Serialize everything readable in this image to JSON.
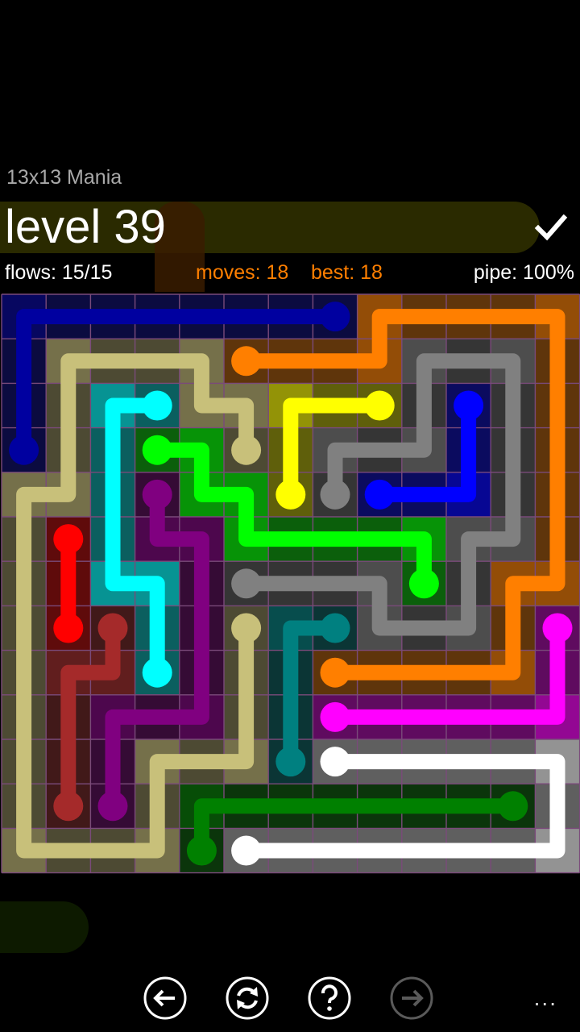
{
  "header": {
    "pack_title": "13x13 Mania",
    "level_label": "level 39",
    "check_icon": "checkmark-icon"
  },
  "stats": {
    "flows": "flows: 15/15",
    "moves": "moves: 18",
    "best": "best: 18",
    "pipe": "pipe: 100%"
  },
  "colors": {
    "background": "#000000",
    "moves_text": "#ff7f00",
    "banner": "#2a2a00",
    "grid_line": "#7a4a7a"
  },
  "board": {
    "size": 13,
    "flows": [
      {
        "name": "navy",
        "color": "#0000a0",
        "path": [
          [
            7,
            0
          ],
          [
            0,
            0
          ],
          [
            0,
            3
          ]
        ]
      },
      {
        "name": "orange",
        "color": "#ff7f00",
        "path": [
          [
            5,
            1
          ],
          [
            8,
            1
          ],
          [
            8,
            0
          ],
          [
            12,
            0
          ],
          [
            12,
            6
          ],
          [
            11,
            6
          ],
          [
            11,
            8
          ],
          [
            7,
            8
          ]
        ]
      },
      {
        "name": "khaki",
        "color": "#c8c07a",
        "path": [
          [
            5,
            3
          ],
          [
            5,
            2
          ],
          [
            4,
            2
          ],
          [
            4,
            1
          ],
          [
            1,
            1
          ],
          [
            1,
            4
          ],
          [
            0,
            4
          ],
          [
            0,
            12
          ],
          [
            3,
            12
          ],
          [
            3,
            10
          ],
          [
            5,
            10
          ],
          [
            5,
            7
          ]
        ]
      },
      {
        "name": "cyan",
        "color": "#00ffff",
        "path": [
          [
            3,
            2
          ],
          [
            2,
            2
          ],
          [
            2,
            6
          ],
          [
            3,
            6
          ],
          [
            3,
            8
          ]
        ]
      },
      {
        "name": "yellow",
        "color": "#ffff00",
        "path": [
          [
            8,
            2
          ],
          [
            6,
            2
          ],
          [
            6,
            4
          ]
        ]
      },
      {
        "name": "gray",
        "color": "#808080",
        "path": [
          [
            7,
            4
          ],
          [
            7,
            3
          ],
          [
            9,
            3
          ],
          [
            9,
            1
          ],
          [
            11,
            1
          ],
          [
            11,
            5
          ],
          [
            10,
            5
          ],
          [
            10,
            7
          ],
          [
            8,
            7
          ],
          [
            8,
            6
          ],
          [
            5,
            6
          ]
        ]
      },
      {
        "name": "blue",
        "color": "#0000ff",
        "path": [
          [
            10,
            2
          ],
          [
            10,
            4
          ],
          [
            8,
            4
          ]
        ]
      },
      {
        "name": "lime",
        "color": "#00ff00",
        "path": [
          [
            3,
            3
          ],
          [
            4,
            3
          ],
          [
            4,
            4
          ],
          [
            5,
            4
          ],
          [
            5,
            5
          ],
          [
            9,
            5
          ],
          [
            9,
            6
          ]
        ]
      },
      {
        "name": "purple",
        "color": "#800080",
        "path": [
          [
            3,
            4
          ],
          [
            3,
            5
          ],
          [
            4,
            5
          ],
          [
            4,
            9
          ],
          [
            2,
            9
          ],
          [
            2,
            11
          ]
        ]
      },
      {
        "name": "red",
        "color": "#ff0000",
        "path": [
          [
            1,
            5
          ],
          [
            1,
            7
          ]
        ]
      },
      {
        "name": "brown",
        "color": "#a52a2a",
        "path": [
          [
            2,
            7
          ],
          [
            2,
            8
          ],
          [
            1,
            8
          ],
          [
            1,
            11
          ]
        ]
      },
      {
        "name": "teal",
        "color": "#008080",
        "path": [
          [
            7,
            7
          ],
          [
            6,
            7
          ],
          [
            6,
            10
          ]
        ]
      },
      {
        "name": "magenta",
        "color": "#ff00ff",
        "path": [
          [
            12,
            7
          ],
          [
            12,
            9
          ],
          [
            7,
            9
          ]
        ]
      },
      {
        "name": "white",
        "color": "#ffffff",
        "path": [
          [
            7,
            10
          ],
          [
            12,
            10
          ],
          [
            12,
            12
          ],
          [
            5,
            12
          ]
        ]
      },
      {
        "name": "green",
        "color": "#008000",
        "path": [
          [
            11,
            11
          ],
          [
            4,
            11
          ],
          [
            4,
            12
          ]
        ]
      }
    ]
  },
  "appbar": {
    "buttons": [
      {
        "name": "back-arrow-icon",
        "enabled": true
      },
      {
        "name": "refresh-icon",
        "enabled": true
      },
      {
        "name": "help-icon",
        "enabled": true
      },
      {
        "name": "forward-arrow-icon",
        "enabled": false
      }
    ],
    "more_label": "..."
  }
}
